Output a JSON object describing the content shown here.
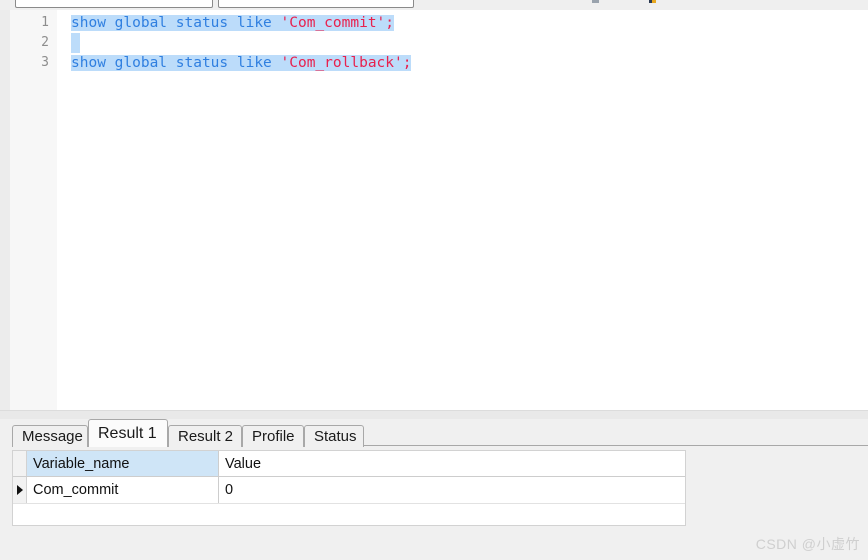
{
  "toolbar": {
    "field_1_value": "",
    "field_2_value": "",
    "icon_1": "toolbar-icon-left",
    "icon_2": "toolbar-icon-right"
  },
  "editor": {
    "line_numbers": [
      "1",
      "2",
      "3"
    ],
    "lines": [
      {
        "number": "1",
        "text": "show global status like 'Com_commit';",
        "tokens": [
          {
            "t": "show global status like ",
            "type": "keyword"
          },
          {
            "t": "'Com_commit'",
            "type": "string"
          },
          {
            "t": ";",
            "type": "punctuation"
          }
        ],
        "selected": true
      },
      {
        "number": "2",
        "text": "",
        "tokens": [],
        "selected": true
      },
      {
        "number": "3",
        "text": "show global status like 'Com_rollback';",
        "tokens": [
          {
            "t": "show global status like ",
            "type": "keyword"
          },
          {
            "t": "'Com_rollback'",
            "type": "string"
          },
          {
            "t": ";",
            "type": "punctuation"
          }
        ],
        "selected": true
      }
    ]
  },
  "results": {
    "tabs": [
      {
        "label": "Message",
        "active": false
      },
      {
        "label": "Result 1",
        "active": true
      },
      {
        "label": "Result 2",
        "active": false
      },
      {
        "label": "Profile",
        "active": false
      },
      {
        "label": "Status",
        "active": false
      }
    ],
    "grid": {
      "columns": [
        "Variable_name",
        "Value"
      ],
      "rows": [
        {
          "Variable_name": "Com_commit",
          "Value": "0",
          "current": true
        }
      ]
    }
  },
  "watermark": {
    "text": "CSDN @小虚竹"
  },
  "colors": {
    "selection": "#bcdcfa",
    "keyword": "#2f7fe0",
    "string": "#e8214e",
    "header_highlight": "#cfe5f7",
    "gutter": "#f7f7f7",
    "panel": "#f0f0f0"
  }
}
